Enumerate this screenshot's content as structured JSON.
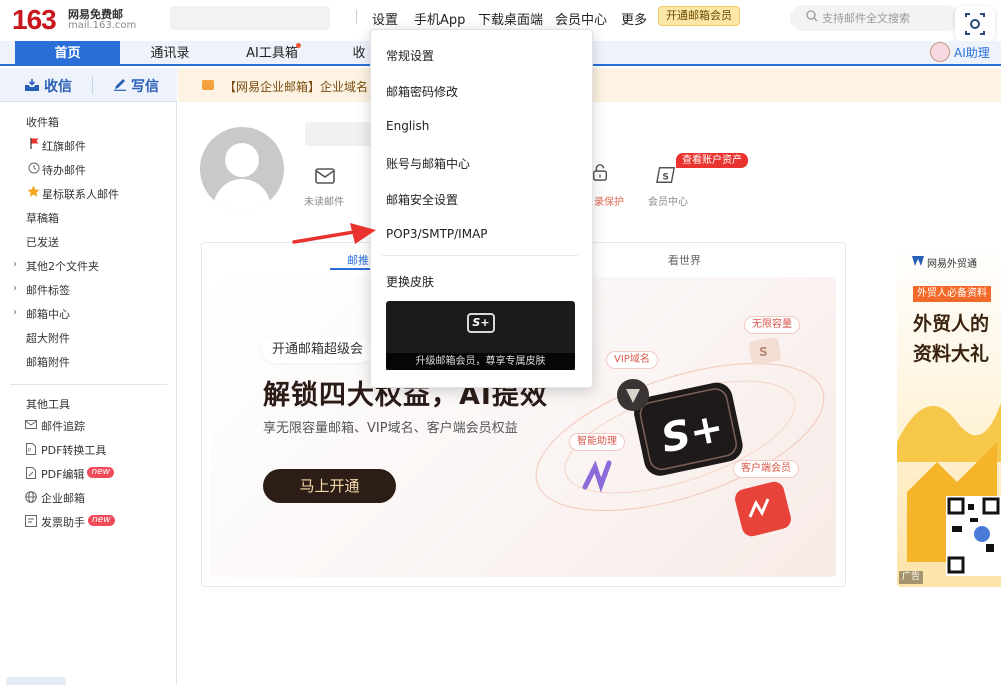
{
  "header": {
    "logo_number": "163",
    "logo_text": "网易免费邮",
    "logo_url": "mail.163.com",
    "nav": [
      {
        "label": "设置"
      },
      {
        "label": "手机App"
      },
      {
        "label": "下载桌面端"
      },
      {
        "label": "会员中心"
      },
      {
        "label": "更多"
      }
    ],
    "vip_badge": "开通邮箱会员",
    "search_placeholder": "支持邮件全文搜索"
  },
  "tabs": [
    {
      "label": "首页",
      "active": true
    },
    {
      "label": "通讯录"
    },
    {
      "label": "AI工具箱"
    },
    {
      "label": "收"
    }
  ],
  "ai_help": "AI助理",
  "sidebar": {
    "receive": "收信",
    "write": "写信",
    "items": [
      {
        "label": "收件箱"
      },
      {
        "label": "红旗邮件"
      },
      {
        "label": "待办邮件"
      },
      {
        "label": "星标联系人邮件"
      },
      {
        "label": "草稿箱"
      },
      {
        "label": "已发送"
      },
      {
        "label": "其他2个文件夹"
      },
      {
        "label": "邮件标签"
      },
      {
        "label": "邮箱中心"
      },
      {
        "label": "超大附件"
      },
      {
        "label": "邮箱附件"
      }
    ],
    "tools_title": "其他工具",
    "tools": [
      {
        "label": "邮件追踪"
      },
      {
        "label": "PDF转换工具"
      },
      {
        "label": "PDF编辑",
        "badge": "new"
      },
      {
        "label": "企业邮箱"
      },
      {
        "label": "发票助手",
        "badge": "new"
      }
    ]
  },
  "notice": "【网易企业邮箱】企业域名",
  "profile": {
    "quick": [
      {
        "label": "未读邮件",
        "icon": "envelope-icon"
      },
      {
        "label": "录保护",
        "icon": "lock-icon"
      },
      {
        "label": "会员中心",
        "icon": "member-s-icon"
      }
    ],
    "asset_badge": "查看账户资产"
  },
  "content_tabs": [
    {
      "label": "邮推",
      "active": true
    },
    {
      "label": "看世界"
    }
  ],
  "banner": {
    "tag": "开通邮箱超级会",
    "title": "解锁四大权益，AI提效",
    "subtitle": "享无限容量邮箱、VIP域名、客户端会员权益",
    "cta": "马上开通",
    "pills": [
      "无限容量",
      "VIP域名",
      "智能助理",
      "客户端会员"
    ]
  },
  "ad": {
    "brand": "网易外贸通",
    "tag": "外贸人必备资料",
    "title_line1": "外贸人的",
    "title_line2": "资料大礼",
    "label": "广告"
  },
  "menu": {
    "items": [
      {
        "label": "常规设置"
      },
      {
        "label": "邮箱密码修改"
      },
      {
        "label": "English"
      },
      {
        "label": "账号与邮箱中心"
      },
      {
        "label": "邮箱安全设置"
      },
      {
        "label": "POP3/SMTP/IMAP"
      },
      {
        "label": "更换皮肤"
      }
    ],
    "skin_caption": "升级邮箱会员，尊享专属皮肤",
    "skin_logo": "S+"
  },
  "colors": {
    "brand_red": "#c8161d",
    "primary_blue": "#2a6fd8",
    "arrow_red": "#e8332e"
  }
}
